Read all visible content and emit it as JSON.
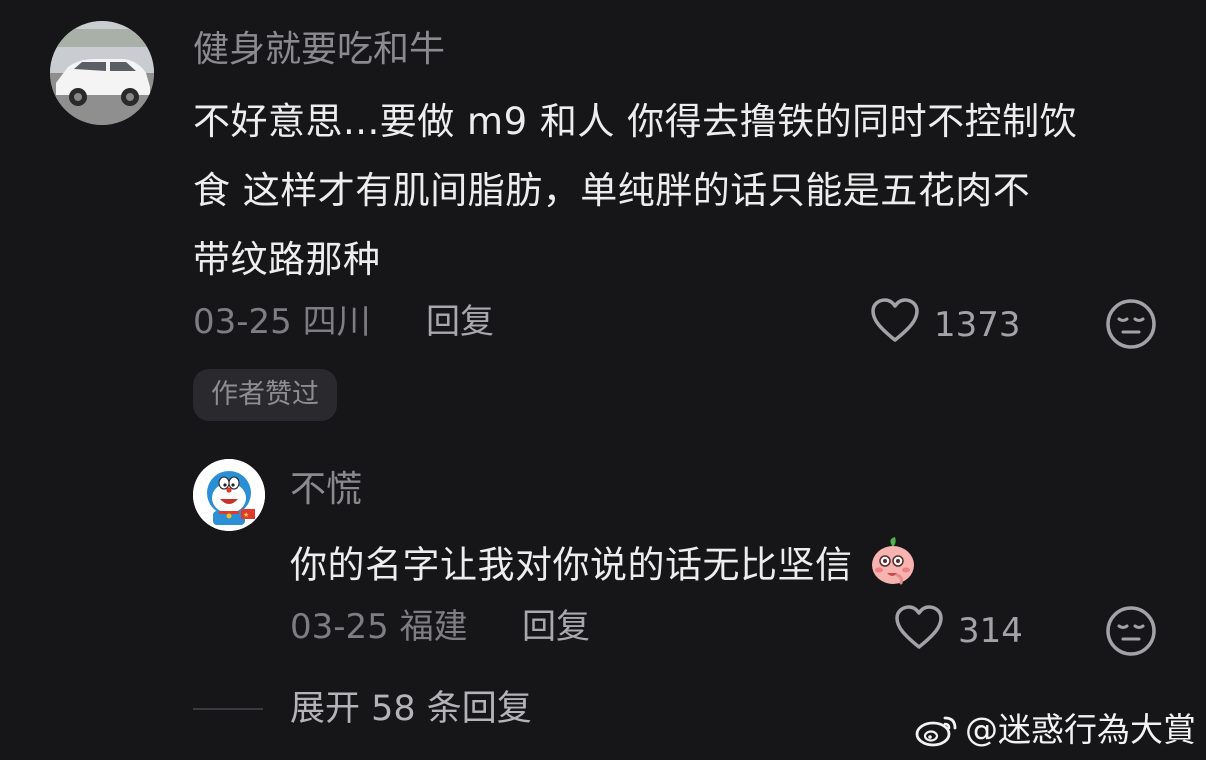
{
  "main_comment": {
    "username": "健身就要吃和牛",
    "text_lines": [
      "不好意思...要做 m9 和人 你得去撸铁的同时不控制饮",
      "食 这样才有肌间脂肪，单纯胖的话只能是五花肉不",
      "带纹路那种"
    ],
    "date": "03-25",
    "location": "四川",
    "reply_label": "回复",
    "like_count": "1373",
    "author_badge": "作者赞过"
  },
  "reply_comment": {
    "username": "不慌",
    "text": "你的名字让我对你说的话无比坚信",
    "emoji_icon": "peach-blush-emoji",
    "date": "03-25",
    "location": "福建",
    "reply_label": "回复",
    "like_count": "314"
  },
  "expand": {
    "label": "展开 58 条回复"
  },
  "watermark": {
    "text": "@迷惑行為大賞",
    "icon": "weibo-logo"
  },
  "colors": {
    "background": "#161619",
    "primary_text": "#ededed",
    "secondary_text": "#8b8b8f",
    "badge_bg": "#2a2a2e"
  }
}
